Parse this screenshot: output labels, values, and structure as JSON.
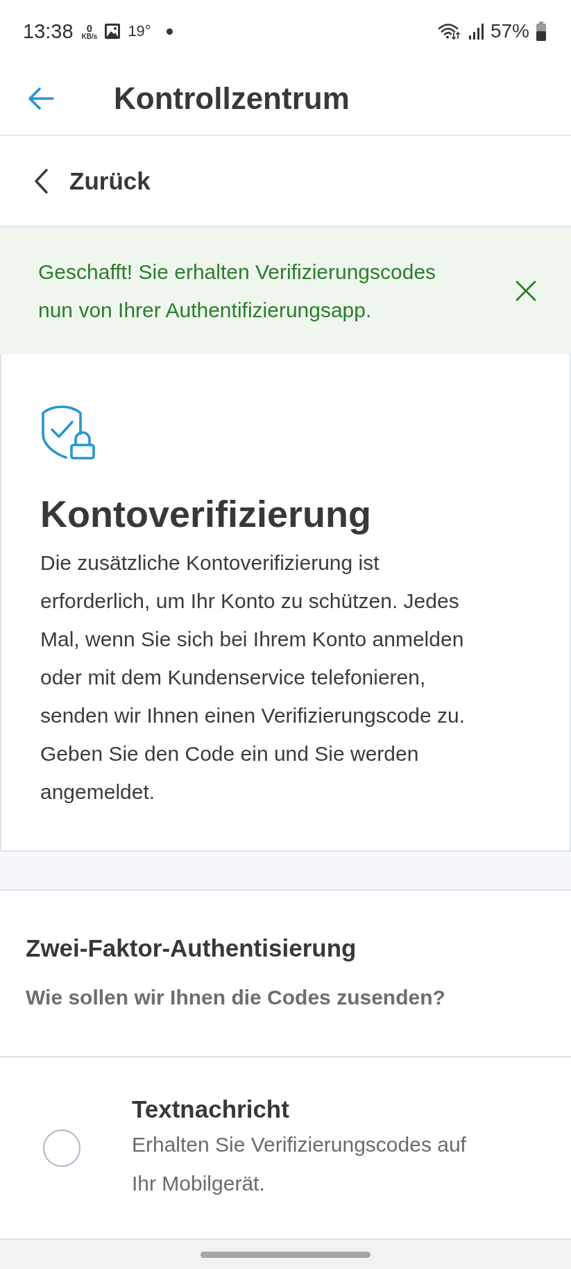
{
  "status_bar": {
    "time": "13:38",
    "net_speed_value": "0",
    "net_speed_unit": "KB/s",
    "temperature": "19°",
    "battery": "57%"
  },
  "header": {
    "title": "Kontrollzentrum"
  },
  "back_link": {
    "label": "Zurück"
  },
  "banner": {
    "message": "Geschafft! Sie erhalten Verifizierungscodes nun von Ihrer Authentifizierungsapp."
  },
  "card": {
    "title": "Kontoverifizierung",
    "body": "Die zusätzliche Kontoverifizierung ist erforderlich, um Ihr Konto zu schützen. Jedes Mal, wenn Sie sich bei Ihrem Konto anmelden oder mit dem Kundenservice telefonieren, senden wir Ihnen einen Verifizierungscode zu. Geben Sie den Code ein und Sie werden angemeldet."
  },
  "section": {
    "title": "Zwei-Faktor-Authentisierung",
    "subtitle": "Wie sollen wir Ihnen die Codes zusenden?"
  },
  "options": [
    {
      "title": "Textnachricht",
      "description": "Erhalten Sie Verifizierungscodes auf Ihr Mobilgerät.",
      "selected": false
    }
  ]
}
